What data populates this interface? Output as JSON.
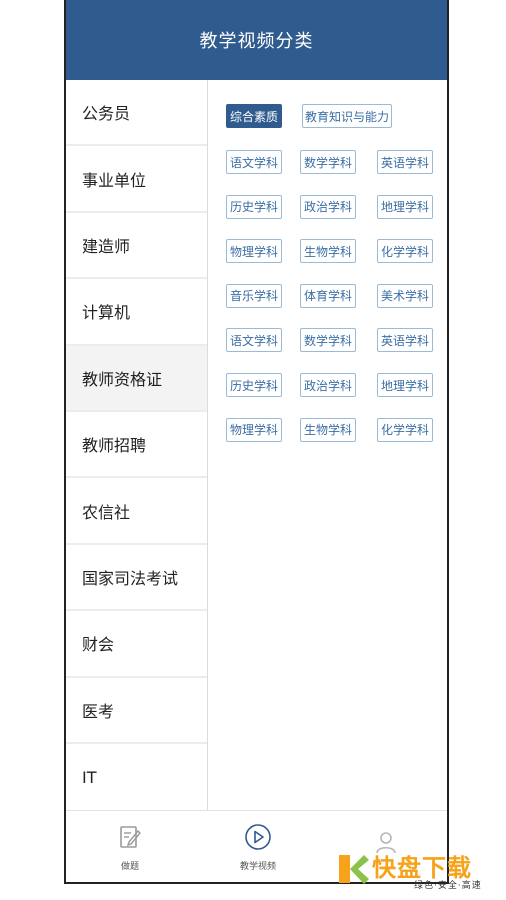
{
  "header": {
    "title": "教学视频分类"
  },
  "sidebar": {
    "items": [
      {
        "label": "公务员"
      },
      {
        "label": "事业单位"
      },
      {
        "label": "建造师"
      },
      {
        "label": "计算机"
      },
      {
        "label": "教师资格证"
      },
      {
        "label": "教师招聘"
      },
      {
        "label": "农信社"
      },
      {
        "label": "国家司法考试"
      },
      {
        "label": "财会"
      },
      {
        "label": "医考"
      },
      {
        "label": "IT"
      }
    ],
    "active_index": 4
  },
  "content": {
    "top_tabs": [
      {
        "label": "综合素质"
      },
      {
        "label": "教育知识与能力"
      }
    ],
    "subjects": [
      "语文学科",
      "数学学科",
      "英语学科",
      "历史学科",
      "政治学科",
      "地理学科",
      "物理学科",
      "生物学科",
      "化学学科",
      "音乐学科",
      "体育学科",
      "美术学科",
      "语文学科",
      "数学学科",
      "英语学科",
      "历史学科",
      "政治学科",
      "地理学科",
      "物理学科",
      "生物学科",
      "化学学科"
    ]
  },
  "tabbar": {
    "items": [
      {
        "label": "做题",
        "icon": "edit-note-icon"
      },
      {
        "label": "教学视频",
        "icon": "play-circle-icon"
      },
      {
        "label": "",
        "icon": "user-icon"
      }
    ]
  },
  "watermark": {
    "brand": "快盘下载",
    "tagline": "绿色·安全·高速"
  },
  "colors": {
    "header": "#2f5b8f",
    "accent": "#3a6ea5",
    "logo_orange": "#f6a21a",
    "logo_green": "#2f8f2f"
  }
}
